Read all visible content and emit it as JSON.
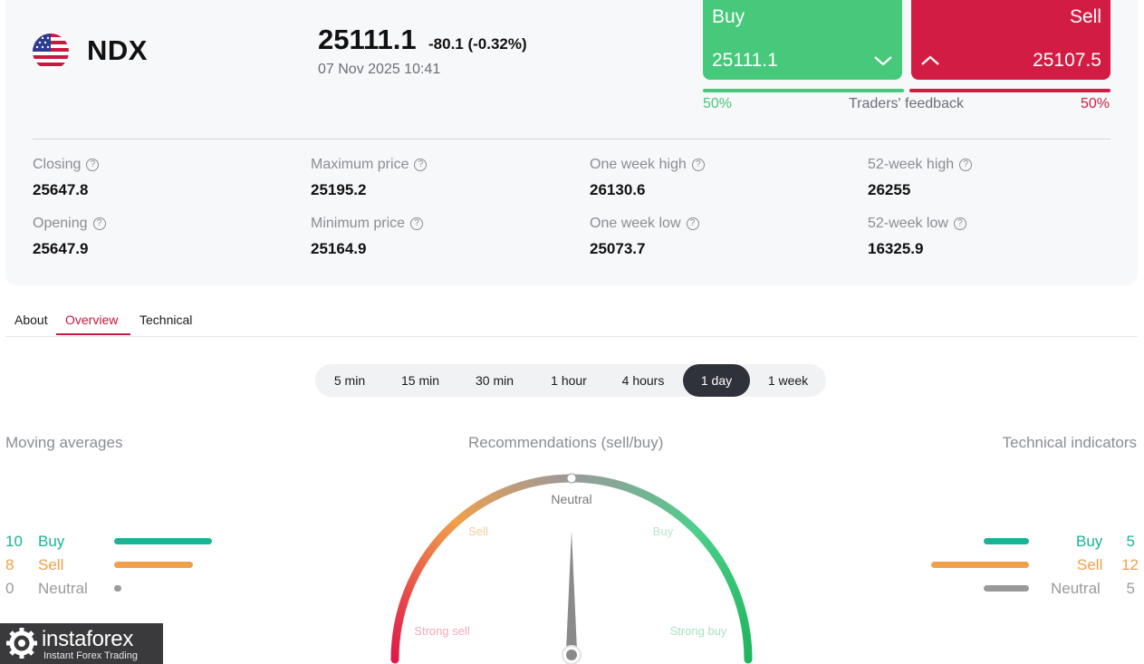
{
  "instrument": {
    "symbol": "NDX",
    "price": "25111.1",
    "change": "-80.1 (-0.32%)",
    "datetime": "07 Nov 2025 10:41"
  },
  "trade": {
    "buy_label": "Buy",
    "buy_price": "25111.1",
    "sell_label": "Sell",
    "sell_price": "25107.5"
  },
  "feedback": {
    "buy_pct": "50%",
    "label": "Traders' feedback",
    "sell_pct": "50%",
    "buy_fraction": 0.5
  },
  "stats": {
    "closing": {
      "label": "Closing",
      "value": "25647.8"
    },
    "opening": {
      "label": "Opening",
      "value": "25647.9"
    },
    "max_price": {
      "label": "Maximum price",
      "value": "25195.2"
    },
    "min_price": {
      "label": "Minimum price",
      "value": "25164.9"
    },
    "week_high": {
      "label": "One week high",
      "value": "26130.6"
    },
    "week_low": {
      "label": "One week low",
      "value": "25073.7"
    },
    "year_high": {
      "label": "52-week high",
      "value": "26255"
    },
    "year_low": {
      "label": "52-week low",
      "value": "16325.9"
    }
  },
  "tabs": {
    "about": "About",
    "overview": "Overview",
    "technical": "Technical",
    "active": "Overview"
  },
  "periods": {
    "items": [
      "5 min",
      "15 min",
      "30 min",
      "1 hour",
      "4 hours",
      "1 day",
      "1 week"
    ],
    "active": "1 day"
  },
  "moving_averages": {
    "title": "Moving averages",
    "buy": {
      "count": "10",
      "label": "Buy"
    },
    "sell": {
      "count": "8",
      "label": "Sell"
    },
    "neutral": {
      "count": "0",
      "label": "Neutral"
    }
  },
  "recommendations": {
    "title": "Recommendations (sell/buy)",
    "labels": {
      "neutral": "Neutral",
      "sell": "Sell",
      "buy": "Buy",
      "strong_sell": "Strong sell",
      "strong_buy": "Strong buy"
    }
  },
  "technical_indicators": {
    "title": "Technical indicators",
    "buy": {
      "count": "5",
      "label": "Buy"
    },
    "sell": {
      "count": "12",
      "label": "Sell"
    },
    "neutral": {
      "count": "5",
      "label": "Neutral"
    }
  },
  "logo": {
    "brand": "instaforex",
    "tagline": "Instant Forex Trading"
  },
  "colors": {
    "buy": "#46c97a",
    "sell": "#d31c43",
    "ma_buy": "#1ab394",
    "ma_sell": "#f0a04b",
    "neutral": "#9a9a9a"
  }
}
